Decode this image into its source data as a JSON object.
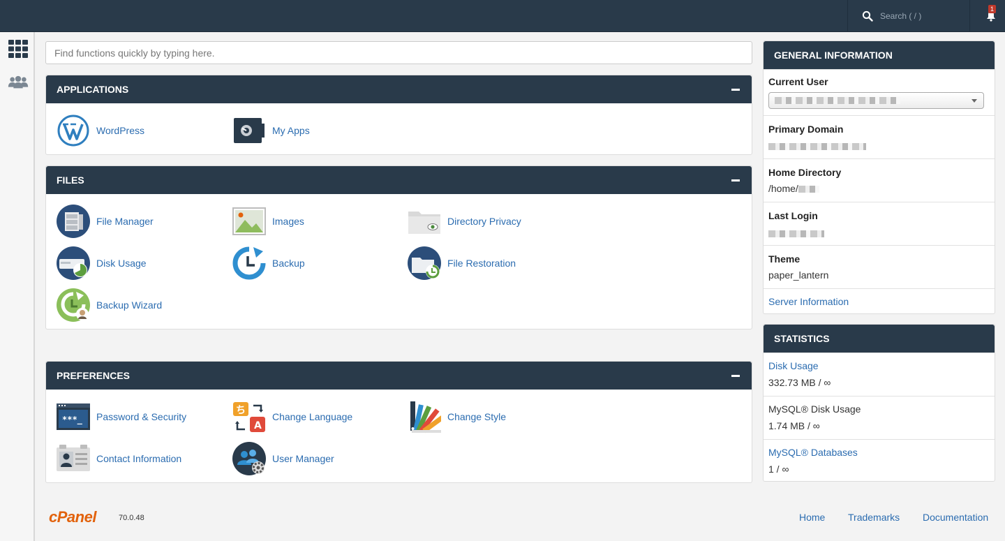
{
  "topbar": {
    "search_placeholder": "Search ( / )",
    "notification_count": "1"
  },
  "main": {
    "quick_search_placeholder": "Find functions quickly by typing here."
  },
  "panels": {
    "applications": {
      "title": "APPLICATIONS",
      "items": [
        "WordPress",
        "My Apps"
      ]
    },
    "files": {
      "title": "FILES",
      "items": [
        "File Manager",
        "Images",
        "Directory Privacy",
        "Disk Usage",
        "Backup",
        "File Restoration",
        "Backup Wizard"
      ]
    },
    "preferences": {
      "title": "PREFERENCES",
      "items": [
        "Password & Security",
        "Change Language",
        "Change Style",
        "Contact Information",
        "User Manager"
      ]
    }
  },
  "general_info": {
    "title": "GENERAL INFORMATION",
    "current_user_label": "Current User",
    "primary_domain_label": "Primary Domain",
    "home_directory_label": "Home Directory",
    "home_directory_prefix": "/home/",
    "last_login_label": "Last Login",
    "theme_label": "Theme",
    "theme_value": "paper_lantern",
    "server_info_link": "Server Information"
  },
  "statistics": {
    "title": "STATISTICS",
    "disk_usage_label": "Disk Usage",
    "disk_usage_value": "332.73 MB / ∞",
    "mysql_disk_label": "MySQL® Disk Usage",
    "mysql_disk_value": "1.74 MB / ∞",
    "mysql_db_label": "MySQL® Databases",
    "mysql_db_value": "1 / ∞"
  },
  "footer": {
    "logo": "cPanel",
    "version": "70.0.48",
    "links": [
      "Home",
      "Trademarks",
      "Documentation"
    ]
  },
  "colors": {
    "header": "#293a4a",
    "link": "#2b6cb0",
    "brand": "#e2620c",
    "badge": "#c0392b"
  }
}
